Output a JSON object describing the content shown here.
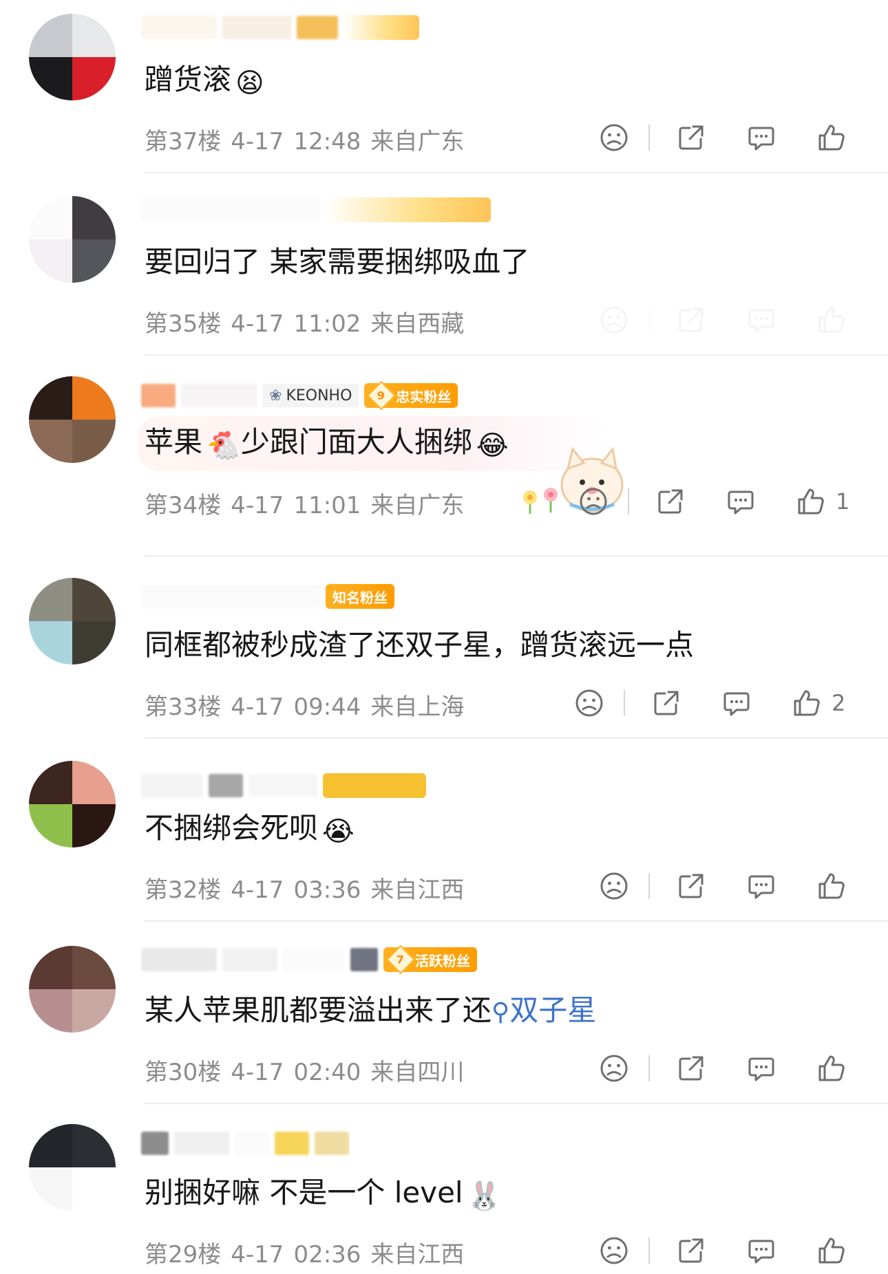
{
  "comments": [
    {
      "text": "蹭货滚",
      "emoji": "😫",
      "floor": "第37楼",
      "date": "4-17",
      "time": "12:48",
      "location": "来自广东",
      "likes": ""
    },
    {
      "text": "要回归了 某家需要捆绑吸血了",
      "floor": "第35楼",
      "date": "4-17",
      "time": "11:02",
      "location": "来自西藏",
      "likes": ""
    },
    {
      "tag": "KEONHO",
      "badge_level": "9",
      "badge_label": "忠实粉丝",
      "text_a": "苹果",
      "emoji_a": "🐔",
      "text_b": "少跟门面大人捆绑",
      "emoji_b": "😂",
      "floor": "第34楼",
      "date": "4-17",
      "time": "11:01",
      "location": "来自广东",
      "likes": "1"
    },
    {
      "badge_label": "知名粉丝",
      "text": "同框都被秒成渣了还双子星，蹭货滚远一点",
      "floor": "第33楼",
      "date": "4-17",
      "time": "09:44",
      "location": "来自上海",
      "likes": "2"
    },
    {
      "text": "不捆绑会死呗",
      "emoji": "😭",
      "floor": "第32楼",
      "date": "4-17",
      "time": "03:36",
      "location": "来自江西",
      "likes": ""
    },
    {
      "badge_level": "7",
      "badge_label": "活跃粉丝",
      "text": "某人苹果肌都要溢出来了还",
      "link": "双子星",
      "floor": "第30楼",
      "date": "4-17",
      "time": "02:40",
      "location": "来自四川",
      "likes": ""
    },
    {
      "text": "别捆好嘛 不是一个 level",
      "emoji": "🐰",
      "floor": "第29楼",
      "date": "4-17",
      "time": "02:36",
      "location": "来自江西",
      "likes": ""
    }
  ],
  "icons": {
    "dislike": "frown-icon",
    "share": "share-icon",
    "comment": "comment-icon",
    "like": "thumbs-up-icon"
  },
  "colors": {
    "badge": "#ffb020",
    "link": "#3d72c8",
    "meta_text": "#8c8c8c"
  }
}
